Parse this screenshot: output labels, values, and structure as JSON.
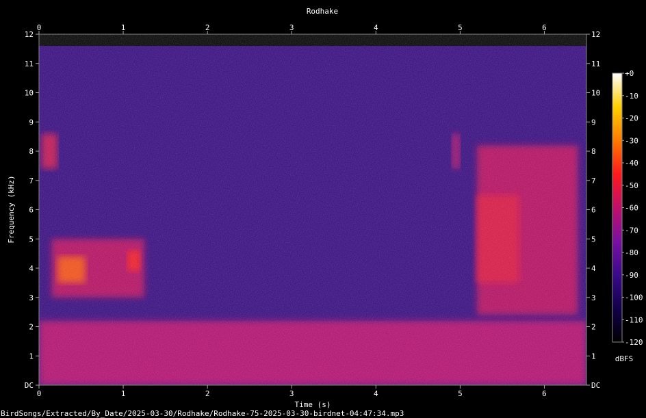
{
  "chart_data": {
    "type": "heatmap",
    "title": "Rodhake",
    "xlabel": "Time (s)",
    "ylabel": "Frequency (kHz)",
    "xlim": [
      0,
      6.5
    ],
    "ylim": [
      0,
      12
    ],
    "x_ticks": [
      "0",
      "1",
      "2",
      "3",
      "4",
      "5",
      "6"
    ],
    "y_ticks": [
      "DC",
      "1",
      "2",
      "3",
      "4",
      "5",
      "6",
      "7",
      "8",
      "9",
      "10",
      "11",
      "12"
    ],
    "colorbar": {
      "label": "dBFS",
      "ticks": [
        "+0",
        "-10",
        "-20",
        "-30",
        "-40",
        "-50",
        "-60",
        "-70",
        "-80",
        "-90",
        "-100",
        "-110",
        "-120"
      ],
      "range": [
        -120,
        0
      ],
      "colormap": [
        "#000000",
        "#12004a",
        "#3a0a8a",
        "#7a10a0",
        "#c0106a",
        "#ff1a1a",
        "#ff7a00",
        "#ffd000",
        "#ffffff"
      ]
    },
    "background_dbfs": -92,
    "noise_floor_region": {
      "freq_khz": [
        0,
        2.2
      ],
      "dbfs": -62
    },
    "calls": [
      {
        "time_s": [
          0.03,
          0.22
        ],
        "freq_khz": [
          7.4,
          8.6
        ],
        "dbfs": -55
      },
      {
        "time_s": [
          0.15,
          1.25
        ],
        "freq_khz": [
          3.0,
          5.0
        ],
        "dbfs": -58
      },
      {
        "time_s": [
          0.22,
          0.55
        ],
        "freq_khz": [
          3.5,
          4.4
        ],
        "dbfs": -35
      },
      {
        "time_s": [
          1.05,
          1.2
        ],
        "freq_khz": [
          3.9,
          4.6
        ],
        "dbfs": -45
      },
      {
        "time_s": [
          4.9,
          5.0
        ],
        "freq_khz": [
          7.4,
          8.6
        ],
        "dbfs": -62
      },
      {
        "time_s": [
          5.2,
          6.4
        ],
        "freq_khz": [
          2.4,
          8.2
        ],
        "dbfs": -58
      },
      {
        "time_s": [
          5.2,
          5.7
        ],
        "freq_khz": [
          3.5,
          6.5
        ],
        "dbfs": -52
      }
    ]
  },
  "footer": {
    "file_path": "BirdSongs/Extracted/By_Date/2025-03-30/Rodhake/Rodhake-75-2025-03-30-birdnet-04:47:34.mp3"
  }
}
